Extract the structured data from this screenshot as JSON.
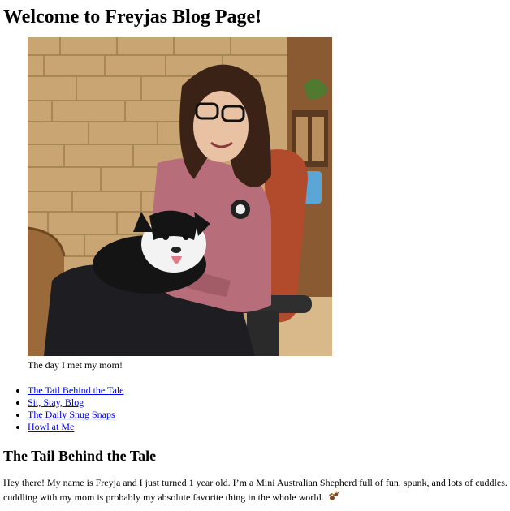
{
  "page": {
    "title": "Welcome to Freyjas Blog Page!"
  },
  "hero": {
    "caption": "The day I met my mom!"
  },
  "nav": {
    "items": [
      {
        "label": "The Tail Behind the Tale"
      },
      {
        "label": "Sit, Stay, Blog"
      },
      {
        "label": "The Daily Snug Snaps"
      },
      {
        "label": "Howl at Me"
      }
    ]
  },
  "section": {
    "heading": "The Tail Behind the Tale",
    "body": "Hey there! My name is Freyja and I just turned 1 year old. I’m a Mini Australian Shepherd full of fun, spunk, and lots of cuddles. cuddling with my mom is probably my absolute favorite thing in the whole world.",
    "emoji_icon": "paw-prints-icon"
  },
  "colors": {
    "link": "#0000ee",
    "text": "#000000"
  }
}
